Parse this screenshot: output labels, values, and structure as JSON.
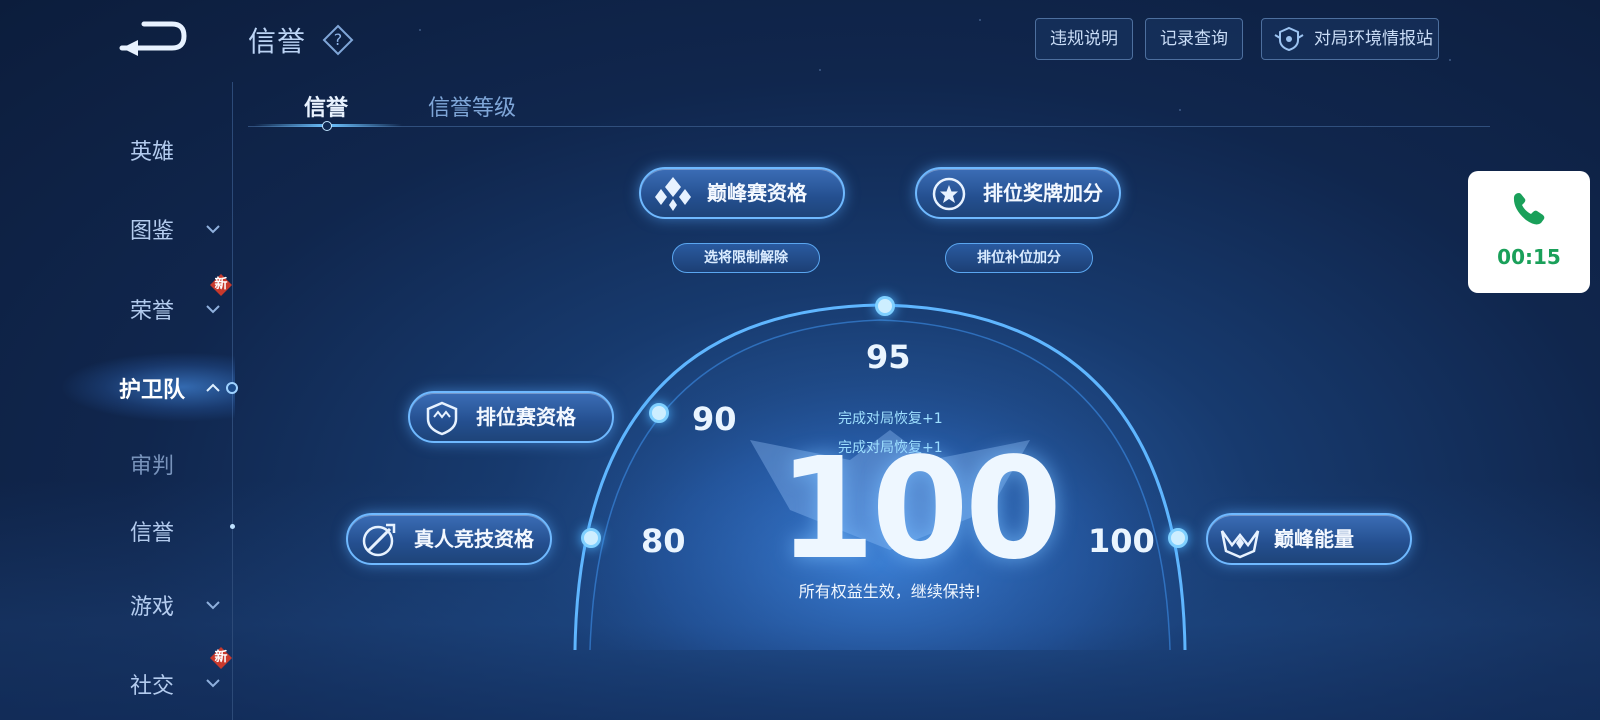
{
  "header": {
    "title": "信誉",
    "help_icon": "question-icon",
    "buttons": {
      "rules": "违规说明",
      "records": "记录查询",
      "station": "对局环境情报站"
    }
  },
  "tabs": {
    "credit": "信誉",
    "credit_level": "信誉等级"
  },
  "sidebar": {
    "items": [
      {
        "label": "英雄"
      },
      {
        "label": "图鉴"
      },
      {
        "label": "荣誉",
        "badge": "新"
      },
      {
        "label": "护卫队"
      },
      {
        "label": "审判"
      },
      {
        "label": "信誉"
      },
      {
        "label": "游戏"
      },
      {
        "label": "社交",
        "badge": "新"
      }
    ]
  },
  "thresholds": {
    "t80": "80",
    "t90": "90",
    "t95": "95",
    "t100": "100"
  },
  "features": {
    "real_player": "真人竞技资格",
    "ranked": "排位赛资格",
    "peak": "巅峰赛资格",
    "medal_bonus": "排位奖牌加分",
    "peak_energy": "巅峰能量"
  },
  "sub_features": {
    "hero_unlock": "选将限制解除",
    "ranked_fill_bonus": "排位补位加分"
  },
  "score": {
    "current": "100",
    "recover_line_1": "完成对局恢复+1",
    "recover_line_2": "完成对局恢复+1",
    "status": "所有权益生效，继续保持!"
  },
  "call": {
    "time": "00:15",
    "icon": "phone-icon"
  },
  "colors": {
    "accent": "#6fb9ff",
    "background": "#10264d",
    "call_green": "#1aa05a"
  }
}
